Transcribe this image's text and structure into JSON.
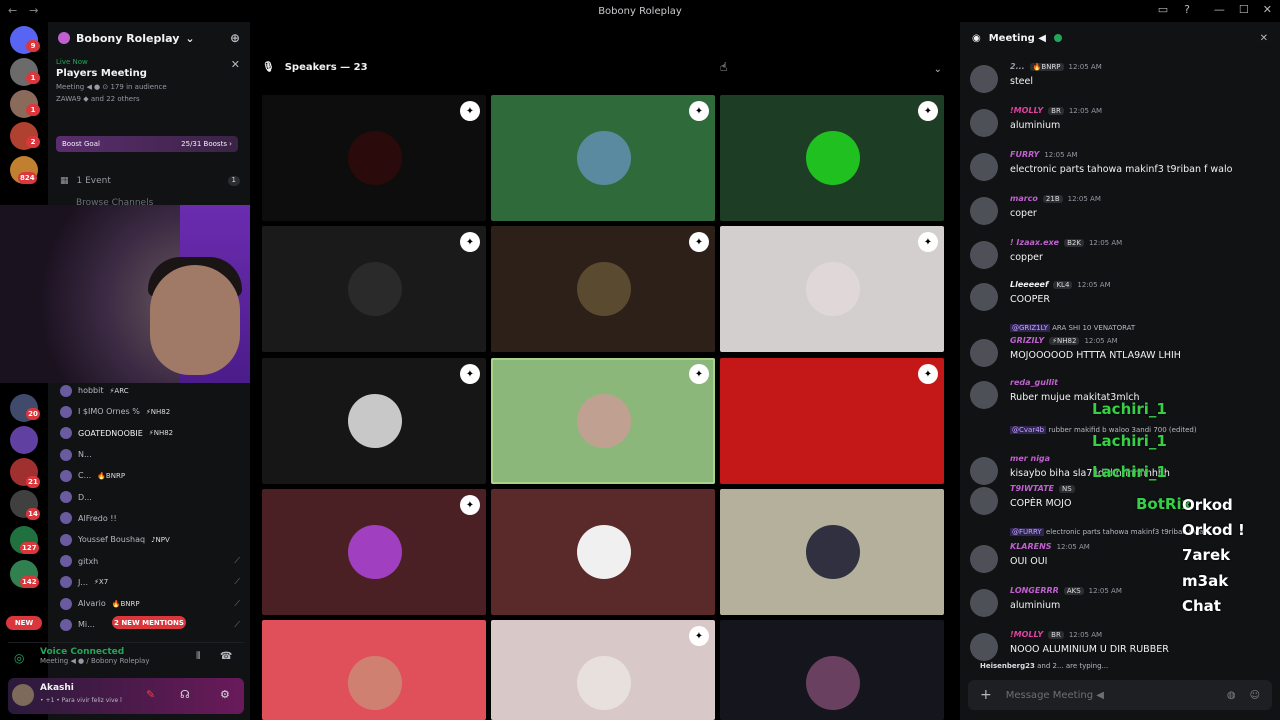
{
  "window": {
    "title": "Bobony Roleplay",
    "nav_back": "←",
    "nav_fwd": "→",
    "minimize": "—",
    "maximize": "☐",
    "close": "✕",
    "inbox_icon": "inbox-icon",
    "help_icon": "?"
  },
  "server_rail": {
    "badges": [
      "9",
      "1",
      "1",
      "2",
      "824",
      "20",
      "21",
      "14",
      "127",
      "142"
    ],
    "new_label": "NEW"
  },
  "sidebar": {
    "server_name": "Bobony Roleplay",
    "server_chevron": "⌄",
    "add_member_icon": "⊕",
    "live": {
      "live_now": "Live Now",
      "title": "Players Meeting",
      "meta": "Meeting ◀ ● ⊙ 179 in audience",
      "speakers": "ZAWA9 ◆ and 22 others",
      "close": "✕"
    },
    "boost": {
      "label": "Boost Goal",
      "progress": "25/31 Boosts ›"
    },
    "event": {
      "label": "1 Event",
      "count": "1"
    },
    "browse": "Browse Channels",
    "members": [
      {
        "name": "hobbit",
        "tag": "⚡ARC",
        "color": "#b5bac1"
      },
      {
        "name": "I $IMO Ornes %",
        "tag": "⚡NH82",
        "color": "#b5bac1"
      },
      {
        "name": "GOATEDNOOBIE",
        "tag": "⚡NH82",
        "color": "#f2f3f5"
      },
      {
        "name": "N...",
        "tag": "",
        "color": "#b5bac1"
      },
      {
        "name": "C...",
        "tag": "🔥BNRP",
        "color": "#b5bac1"
      },
      {
        "name": "D...",
        "tag": "",
        "color": "#b5bac1"
      },
      {
        "name": "AlFredo !!",
        "tag": "",
        "color": "#b5bac1"
      },
      {
        "name": "Youssef Boushaq",
        "tag": "♪NPV",
        "color": "#b5bac1"
      },
      {
        "name": "gitxh",
        "tag": "",
        "color": "#b5bac1"
      },
      {
        "name": "J...",
        "tag": "⚡X7",
        "color": "#b5bac1"
      },
      {
        "name": "Alvario",
        "tag": "🔥BNRP",
        "color": "#b5bac1"
      },
      {
        "name": "Mi...",
        "tag": "",
        "color": "#b5bac1"
      }
    ],
    "mentions": "2 NEW MENTIONS",
    "voice": {
      "status": "Voice Connected",
      "sub": "Meeting ◀ ● / Bobony Roleplay"
    },
    "user": {
      "name": "Akashi",
      "status": "• +1 • Para vivir feliz vive l"
    }
  },
  "stage": {
    "header": "Speakers — 23",
    "tiles": [
      {
        "bg": "#0d0d0d",
        "pic": "#2a0a0a",
        "active": true
      },
      {
        "bg": "#2e6a3a",
        "pic": "#5a8aa0",
        "active": true
      },
      {
        "bg": "#1d3d24",
        "pic": "#20c020",
        "active": true
      },
      {
        "bg": "#1a1a1a",
        "pic": "#2a2a2a",
        "active": true
      },
      {
        "bg": "#2d2018",
        "pic": "#5a4a30",
        "active": true
      },
      {
        "bg": "#d4cfcf",
        "pic": "#e0d8d8",
        "active": true
      },
      {
        "bg": "#161616",
        "pic": "#c8c8c8",
        "active": true
      },
      {
        "bg": "#8bb87a",
        "pic": "#c0a090",
        "active": true
      },
      {
        "bg": "#c41818",
        "pic": "#c41818",
        "active": true
      },
      {
        "bg": "#4a2025",
        "pic": "#a040c0",
        "active": true
      },
      {
        "bg": "#5a2a2a",
        "pic": "#f0f0f0",
        "active": false
      },
      {
        "bg": "#b5b09c",
        "pic": "#303040",
        "active": false
      },
      {
        "bg": "#e0505a",
        "pic": "#d08070",
        "active": false
      },
      {
        "bg": "#d8c8c8",
        "pic": "#e8e0dc",
        "active": true
      },
      {
        "bg": "#15151d",
        "pic": "#6a4060",
        "active": false
      }
    ]
  },
  "chat": {
    "title": "Meeting ◀",
    "close": "✕",
    "messages": [
      {
        "name": "2...",
        "tag": "🔥BNRP",
        "time": "12:05 AM",
        "text": "steel",
        "color": "#949ba4"
      },
      {
        "name": "!MOLLY",
        "tag": "BR",
        "time": "12:05 AM",
        "text": "aluminium",
        "color": "#e040a0"
      },
      {
        "name": "FURRY",
        "tag": "",
        "time": "12:05 AM",
        "text": "electronic parts tahowa makinf3 t9riban f walo",
        "color": "#c060d0"
      },
      {
        "name": "marco",
        "tag": "21B",
        "time": "12:05 AM",
        "text": "coper",
        "color": "#c060d0"
      },
      {
        "name": "! Izaax.exe",
        "tag": "B2K",
        "time": "12:05 AM",
        "text": "copper",
        "color": "#c060d0"
      },
      {
        "name": "Lleeeeef",
        "tag": "KL4",
        "time": "12:05 AM",
        "text": "COOPER",
        "color": "#f2f3f5"
      },
      {
        "name": "GRIZILY",
        "tag": "⚡NH82",
        "time": "12:05 AM",
        "text": "MOJOOOOOD HTTTA NTLA9AW LHIH",
        "color": "#c060d0"
      },
      {
        "name": "reda_gullit",
        "tag": "",
        "time": "",
        "text": "Ruber mujue makitat3mlch",
        "color": "#c060d0"
      },
      {
        "name": "mer niga",
        "tag": "",
        "time": "",
        "text": "kisaybo biha sla7 idid hhhhhhhhh",
        "color": "#c060d0"
      },
      {
        "name": "T9IWTATE",
        "tag": "NS",
        "time": "",
        "text": "COPÈR MOJO",
        "color": "#c060d0"
      },
      {
        "name": "KLARENS",
        "tag": "",
        "time": "12:05 AM",
        "text": "OUI OUI",
        "color": "#c060d0"
      },
      {
        "name": "LONGERRR",
        "tag": "AKS",
        "time": "12:05 AM",
        "text": "aluminium",
        "color": "#c060d0"
      },
      {
        "name": "!MOLLY",
        "tag": "BR",
        "time": "12:05 AM",
        "text": "NOOO ALUMINIUM U DIR RUBBER",
        "color": "#e040a0"
      }
    ],
    "replies": [
      {
        "user": "@GRIZ1LY",
        "text": "ARA SHI 10 VENATORAT"
      },
      {
        "user": "@Cvar4b",
        "text": "rubber makifid b waloo 3andi 700 (edited)"
      },
      {
        "user": "@FURRY",
        "text": "electronic parts tahowa makinf3 t9riban f walo"
      }
    ],
    "overlays": {
      "lachiri": "Lachiri_1",
      "botrix": "BotRix",
      "orkod1": "Orkod",
      "orkod2": "Orkod !",
      "tarek": "7arek",
      "m3ak": "m3ak",
      "chatw": "Chat"
    },
    "typing": {
      "who": "Heisenberg23",
      "rest": "and 2... are typing..."
    },
    "composer_placeholder": "Message Meeting ◀"
  }
}
